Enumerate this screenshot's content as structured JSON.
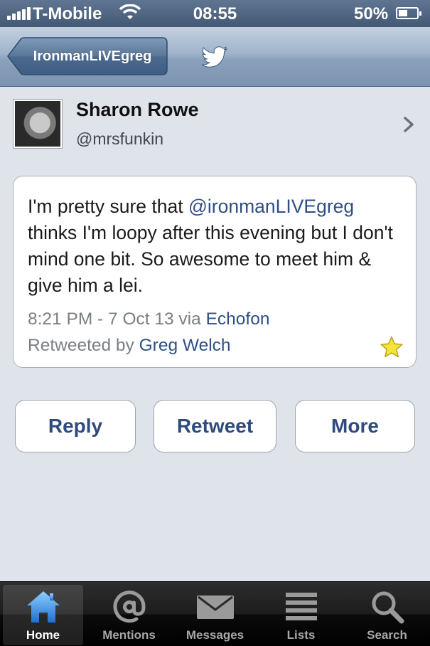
{
  "status_bar": {
    "carrier": "T-Mobile",
    "time": "08:55",
    "battery_percent": "50%",
    "battery_level": 0.5,
    "signal_bars": 5
  },
  "nav_bar": {
    "back_label": "IronmanLIVEgreg",
    "center_icon": "twitter-bird-icon"
  },
  "profile": {
    "name": "Sharon Rowe",
    "handle": "@mrsfunkin"
  },
  "tweet": {
    "text_before": "I'm pretty sure that ",
    "mention": "@ironmanLIVEgreg",
    "text_after": " thinks I'm loopy after this evening but I don't mind one bit. So awesome to meet him & give him a lei.",
    "timestamp": "8:21 PM - 7 Oct 13 via ",
    "source": "Echofon",
    "retweeted_prefix": "Retweeted by ",
    "retweeted_by": "Greg Welch",
    "favorite_icon": "star-icon"
  },
  "actions": {
    "reply": "Reply",
    "retweet": "Retweet",
    "more": "More"
  },
  "tab_bar": {
    "tabs": [
      {
        "label": "Home",
        "icon": "home-icon",
        "selected": true
      },
      {
        "label": "Mentions",
        "icon": "at-sign-icon",
        "selected": false
      },
      {
        "label": "Messages",
        "icon": "envelope-icon",
        "selected": false
      },
      {
        "label": "Lists",
        "icon": "list-icon",
        "selected": false
      },
      {
        "label": "Search",
        "icon": "magnifier-icon",
        "selected": false
      }
    ]
  },
  "colors": {
    "link": "#2f4f86",
    "accent_home": "#3a8ee6",
    "star": "#f5e13a"
  }
}
